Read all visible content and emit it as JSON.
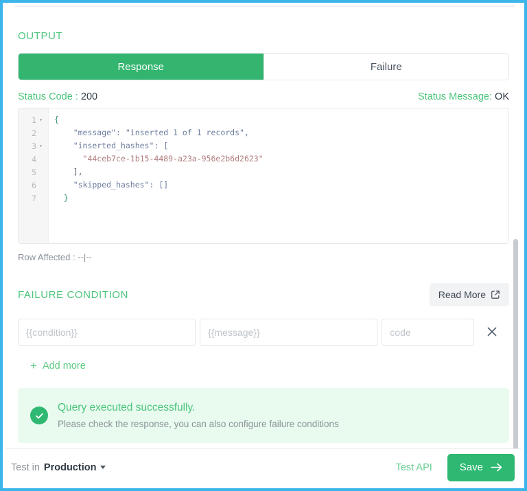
{
  "window": {
    "border_color": "#3cb6ea"
  },
  "output": {
    "section_title": "OUTPUT",
    "tabs": [
      {
        "label": "Response",
        "active": true
      },
      {
        "label": "Failure",
        "active": false
      }
    ],
    "status": {
      "code_label": "Status Code :",
      "code_value": "200",
      "message_label": "Status Message:",
      "message_value": "OK"
    },
    "editor": {
      "line_numbers": [
        "1",
        "2",
        "3",
        "4",
        "5",
        "6",
        "7"
      ],
      "fold_markers": [
        "▾",
        "",
        "▾",
        "",
        "",
        "",
        ""
      ],
      "lines": [
        "{",
        "    \"message\": \"inserted 1 of 1 records\",",
        "    \"inserted_hashes\": [",
        "      \"44ceb7ce-1b15-4489-a23a-956e2b6d2623\"",
        "    ],",
        "    \"skipped_hashes\": []",
        "  }"
      ],
      "raw_json": {
        "message": "inserted 1 of 1 records",
        "inserted_hashes": [
          "44ceb7ce-1b15-4489-a23a-956e2b6d2623"
        ],
        "skipped_hashes": []
      }
    },
    "row_affected": "Row Affected : --|--"
  },
  "failure_condition": {
    "section_title": "FAILURE CONDITION",
    "read_more_label": "Read More",
    "read_more_icon": "external-link-icon",
    "rows": [
      {
        "condition_value": "",
        "condition_placeholder": "{{condition}}",
        "message_value": "",
        "message_placeholder": "{{message}}",
        "code_value": "",
        "code_placeholder": "code",
        "delete_icon": "close-icon"
      }
    ],
    "add_more_label": "Add more",
    "add_more_icon": "plus-icon"
  },
  "banner": {
    "icon": "check-circle-icon",
    "title": "Query executed successfully.",
    "subtitle": "Please check the response, you can also configure failure conditions",
    "background_color": "#e9fbef",
    "accent_color": "#2eb872"
  },
  "bottom_bar": {
    "test_in_label": "Test in",
    "environment": "Production",
    "environment_caret_icon": "chevron-down-icon",
    "test_api_label": "Test API",
    "save_label": "Save",
    "save_icon": "arrow-right-icon"
  }
}
